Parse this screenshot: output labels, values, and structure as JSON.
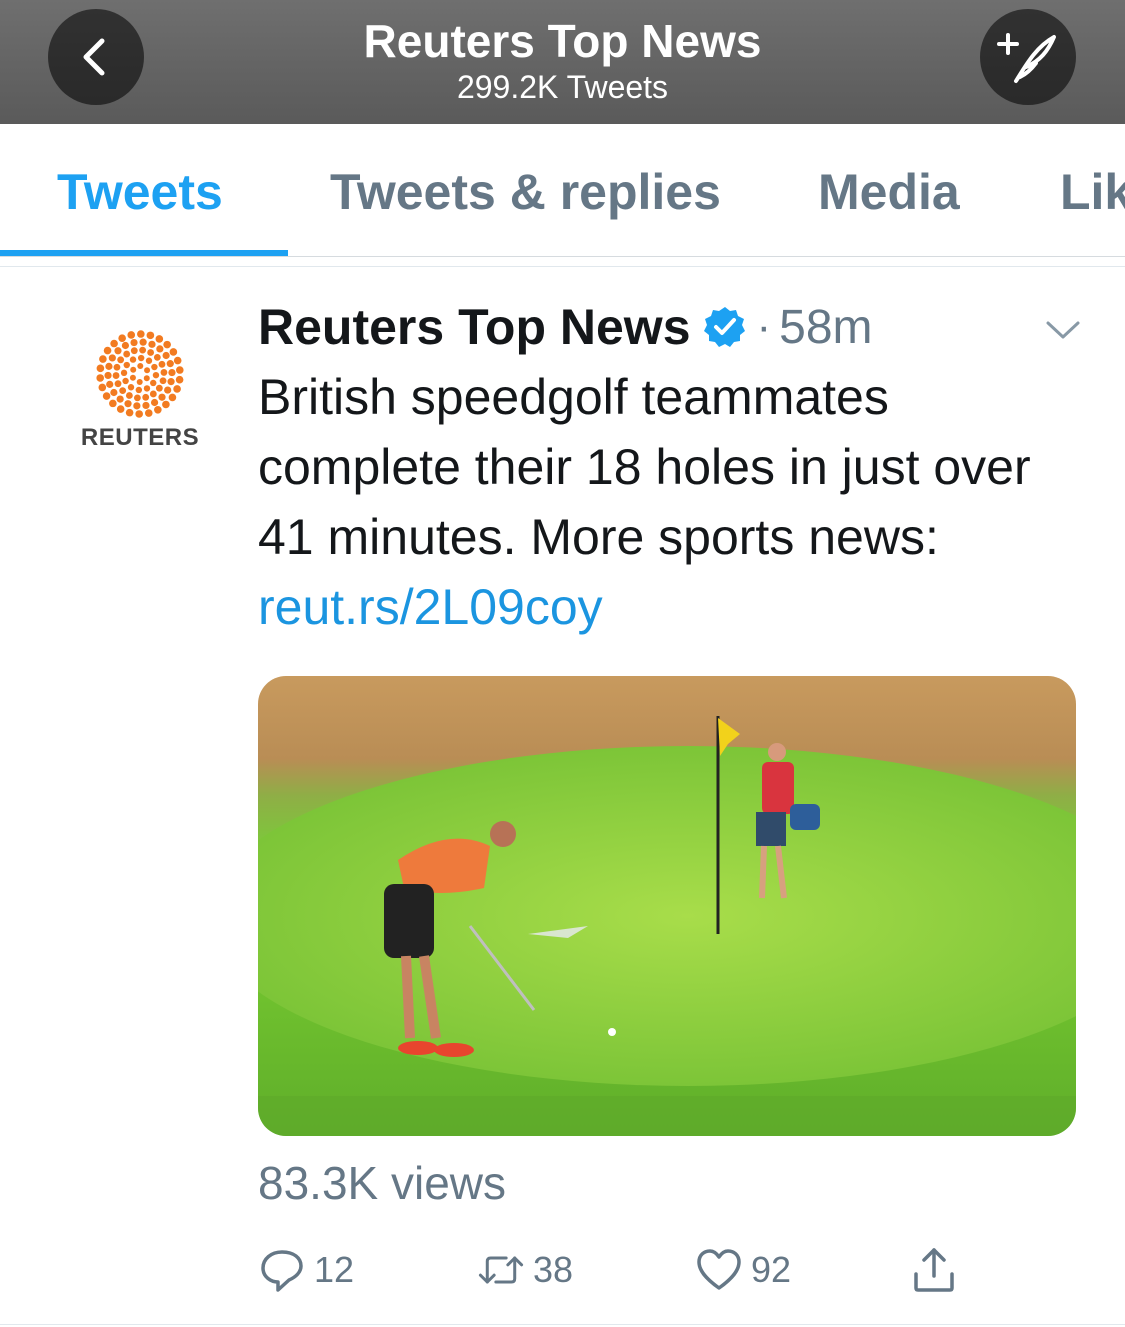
{
  "header": {
    "title": "Reuters Top News",
    "subtitle": "299.2K Tweets",
    "back_icon": "chevron-left-icon",
    "compose_icon": "compose-feather-icon"
  },
  "tabs": [
    {
      "label": "Tweets",
      "active": true
    },
    {
      "label": "Tweets & replies",
      "active": false
    },
    {
      "label": "Media",
      "active": false
    },
    {
      "label": "Lik",
      "active": false
    }
  ],
  "tweet": {
    "avatar_text": "REUTERS",
    "author": "Reuters Top News",
    "verified": true,
    "separator": "·",
    "time": "58m",
    "text": "British speedgolf teammates complete their 18 holes in just over 41 minutes. More sports news: ",
    "link": "reut.rs/2L09coy",
    "views": "83.3K views",
    "actions": {
      "replies": "12",
      "retweets": "38",
      "likes": "92"
    }
  },
  "colors": {
    "accent": "#1da1f2",
    "link": "#1b95e0",
    "muted": "#657786",
    "reuters_orange": "#f27b21"
  }
}
